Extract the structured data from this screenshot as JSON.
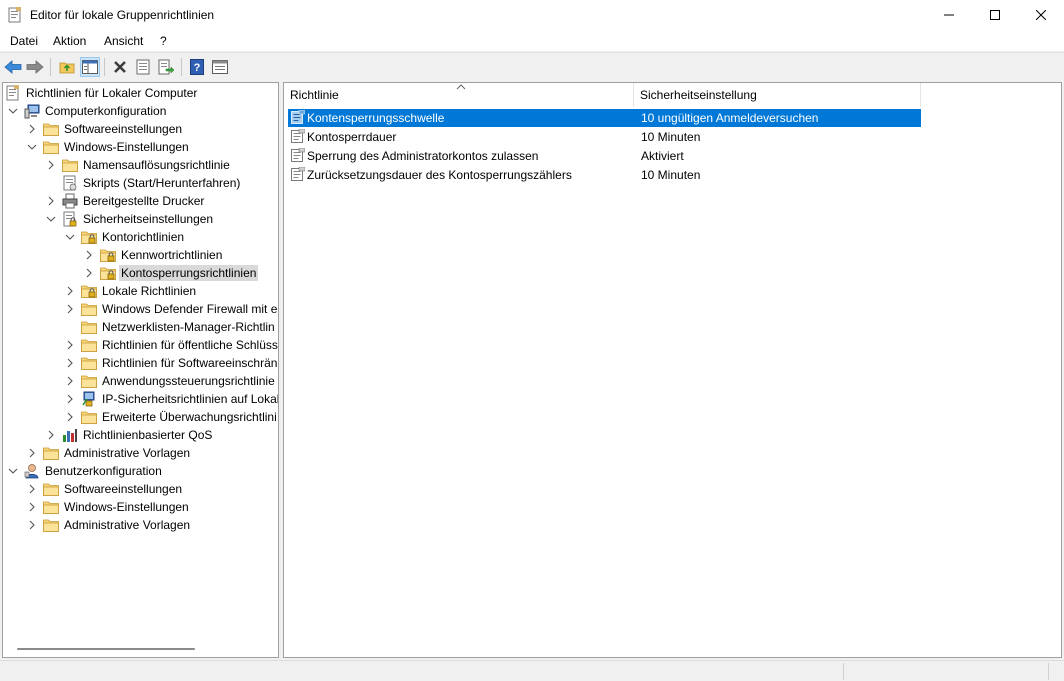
{
  "window": {
    "title": "Editor für lokale Gruppenrichtlinien"
  },
  "menu": {
    "items": [
      "Datei",
      "Aktion",
      "Ansicht",
      "?"
    ]
  },
  "toolbar": {
    "buttons": [
      "back-icon",
      "forward-icon",
      "up-folder-icon",
      "show-hide-tree-icon",
      "delete-icon",
      "properties-icon",
      "export-icon",
      "help-icon",
      "console-view-icon"
    ]
  },
  "tree": {
    "items": [
      {
        "label": "Richtlinien für Lokaler Computer",
        "icon": "policy-doc-icon"
      },
      {
        "label": "Computerkonfiguration",
        "icon": "computer-icon"
      },
      {
        "label": "Softwareeinstellungen",
        "icon": "folder-icon"
      },
      {
        "label": "Windows-Einstellungen",
        "icon": "folder-icon"
      },
      {
        "label": "Namensauflösungsrichtlinie",
        "icon": "folder-icon"
      },
      {
        "label": "Skripts (Start/Herunterfahren)",
        "icon": "script-icon"
      },
      {
        "label": "Bereitgestellte Drucker",
        "icon": "printer-icon"
      },
      {
        "label": "Sicherheitseinstellungen",
        "icon": "security-icon"
      },
      {
        "label": "Kontorichtlinien",
        "icon": "locked-folder-icon"
      },
      {
        "label": "Kennwortrichtlinien",
        "icon": "locked-folder-icon"
      },
      {
        "label": "Kontosperrungsrichtlinien",
        "icon": "locked-folder-icon"
      },
      {
        "label": "Lokale Richtlinien",
        "icon": "locked-folder-icon"
      },
      {
        "label": "Windows Defender Firewall mit er",
        "icon": "folder-icon"
      },
      {
        "label": "Netzwerklisten-Manager-Richtlin",
        "icon": "folder-icon"
      },
      {
        "label": "Richtlinien für öffentliche Schlüss",
        "icon": "folder-icon"
      },
      {
        "label": "Richtlinien für Softwareeinschrän",
        "icon": "folder-icon"
      },
      {
        "label": "Anwendungssteuerungsrichtlinie",
        "icon": "folder-icon"
      },
      {
        "label": "IP-Sicherheitsrichtlinien auf Lokal",
        "icon": "ipsec-icon"
      },
      {
        "label": "Erweiterte Überwachungsrichtlini",
        "icon": "folder-icon"
      },
      {
        "label": "Richtlinienbasierter QoS",
        "icon": "qos-chart-icon"
      },
      {
        "label": "Administrative Vorlagen",
        "icon": "folder-icon"
      },
      {
        "label": "Benutzerkonfiguration",
        "icon": "user-icon"
      },
      {
        "label": "Softwareeinstellungen",
        "icon": "folder-icon"
      },
      {
        "label": "Windows-Einstellungen",
        "icon": "folder-icon"
      },
      {
        "label": "Administrative Vorlagen",
        "icon": "folder-icon"
      }
    ]
  },
  "list": {
    "columns": [
      "Richtlinie",
      "Sicherheitseinstellung"
    ],
    "rows": [
      {
        "policy": "Kontensperrungsschwelle",
        "setting": "10 ungültigen Anmeldeversuchen"
      },
      {
        "policy": "Kontosperrdauer",
        "setting": "10 Minuten"
      },
      {
        "policy": "Sperrung des Administratorkontos zulassen",
        "setting": "Aktiviert"
      },
      {
        "policy": "Zurücksetzungsdauer des Kontosperrungszählers",
        "setting": "10 Minuten"
      }
    ]
  },
  "colors": {
    "selection": "#0078d7",
    "tree_selection": "#d9d9d9",
    "folder": "#f6d365"
  }
}
